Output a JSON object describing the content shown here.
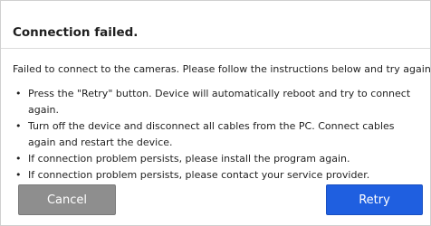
{
  "dialog": {
    "title": "Connection failed.",
    "intro": "Failed to connect to the cameras. Please follow the instructions below and try again.",
    "bullet_glyph": "•",
    "bullets": [
      "Press the \"Retry\" button. Device will automatically reboot and try to connect again.",
      "Turn off the device and disconnect all cables from the PC. Connect cables again and restart the device.",
      "If connection problem persists, please install the program again.",
      "If connection problem persists, please contact your service provider."
    ],
    "cancel_label": "Cancel",
    "retry_label": "Retry"
  },
  "colors": {
    "cancel_button": "#8e8e8e",
    "retry_button": "#1f5fe0",
    "background": "#ffffff"
  }
}
